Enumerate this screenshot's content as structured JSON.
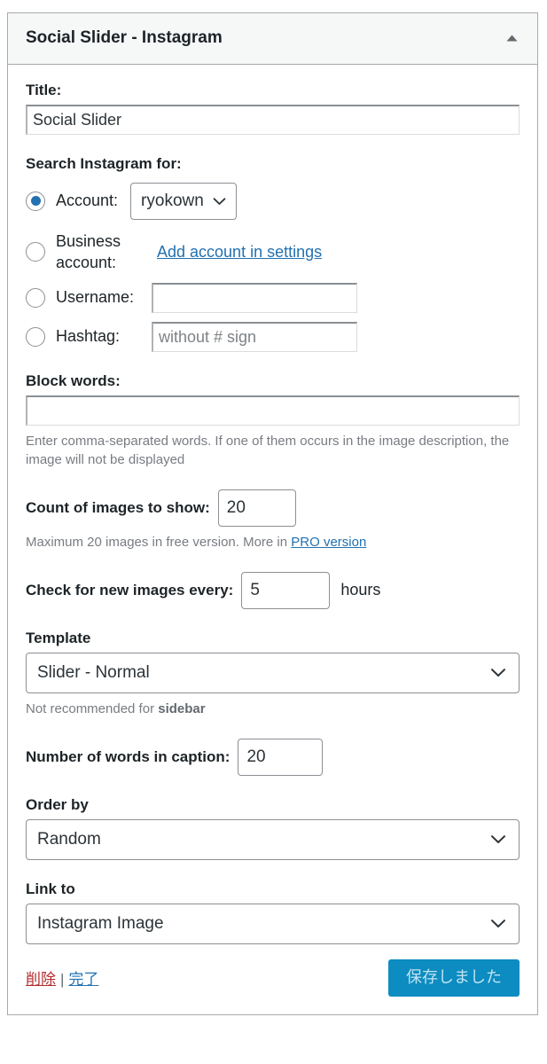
{
  "widget": {
    "title": "Social Slider - Instagram",
    "collapse_icon": "chevron-up-icon"
  },
  "title_field": {
    "label": "Title:",
    "value": "Social Slider"
  },
  "search_section": {
    "label": "Search Instagram for:",
    "options": [
      {
        "id": "account",
        "label": "Account:",
        "selected": true,
        "dropdown_value": "ryokown",
        "dropdown_icon": "chevron-down-icon"
      },
      {
        "id": "business-account",
        "label": "Business account:",
        "selected": false,
        "link_label": "Add account in settings"
      },
      {
        "id": "username",
        "label": "Username:",
        "selected": false,
        "value": "",
        "placeholder": ""
      },
      {
        "id": "hashtag",
        "label": "Hashtag:",
        "selected": false,
        "value": "",
        "placeholder": "without # sign"
      }
    ]
  },
  "block_words": {
    "label": "Block words:",
    "value": "",
    "placeholder": "",
    "helper": "Enter comma-separated words. If one of them occurs in the image description, the image will not be displayed"
  },
  "count_images": {
    "label": "Count of images to show:",
    "value": "20",
    "helper_prefix": "Maximum 20 images in free version. More in ",
    "helper_link": "PRO version"
  },
  "check_interval": {
    "label": "Check for new images every:",
    "value": "5",
    "suffix": "hours"
  },
  "template": {
    "label": "Template",
    "value": "Slider - Normal",
    "icon": "chevron-down-icon",
    "helper_prefix": "Not recommended for ",
    "helper_bold": "sidebar"
  },
  "caption_words": {
    "label": "Number of words in caption:",
    "value": "20"
  },
  "order_by": {
    "label": "Order by",
    "value": "Random",
    "icon": "chevron-down-icon"
  },
  "link_to": {
    "label": "Link to",
    "value": "Instagram Image",
    "icon": "chevron-down-icon"
  },
  "footer": {
    "delete_label": "削除",
    "separator": "|",
    "done_label": "完了",
    "save_label": "保存しました"
  },
  "colors": {
    "accent": "#2271b1",
    "save_button_bg": "#0c8cc0",
    "delete_link": "#b32d2e",
    "header_bg": "#f6f7f7",
    "border": "#a7aaad"
  }
}
